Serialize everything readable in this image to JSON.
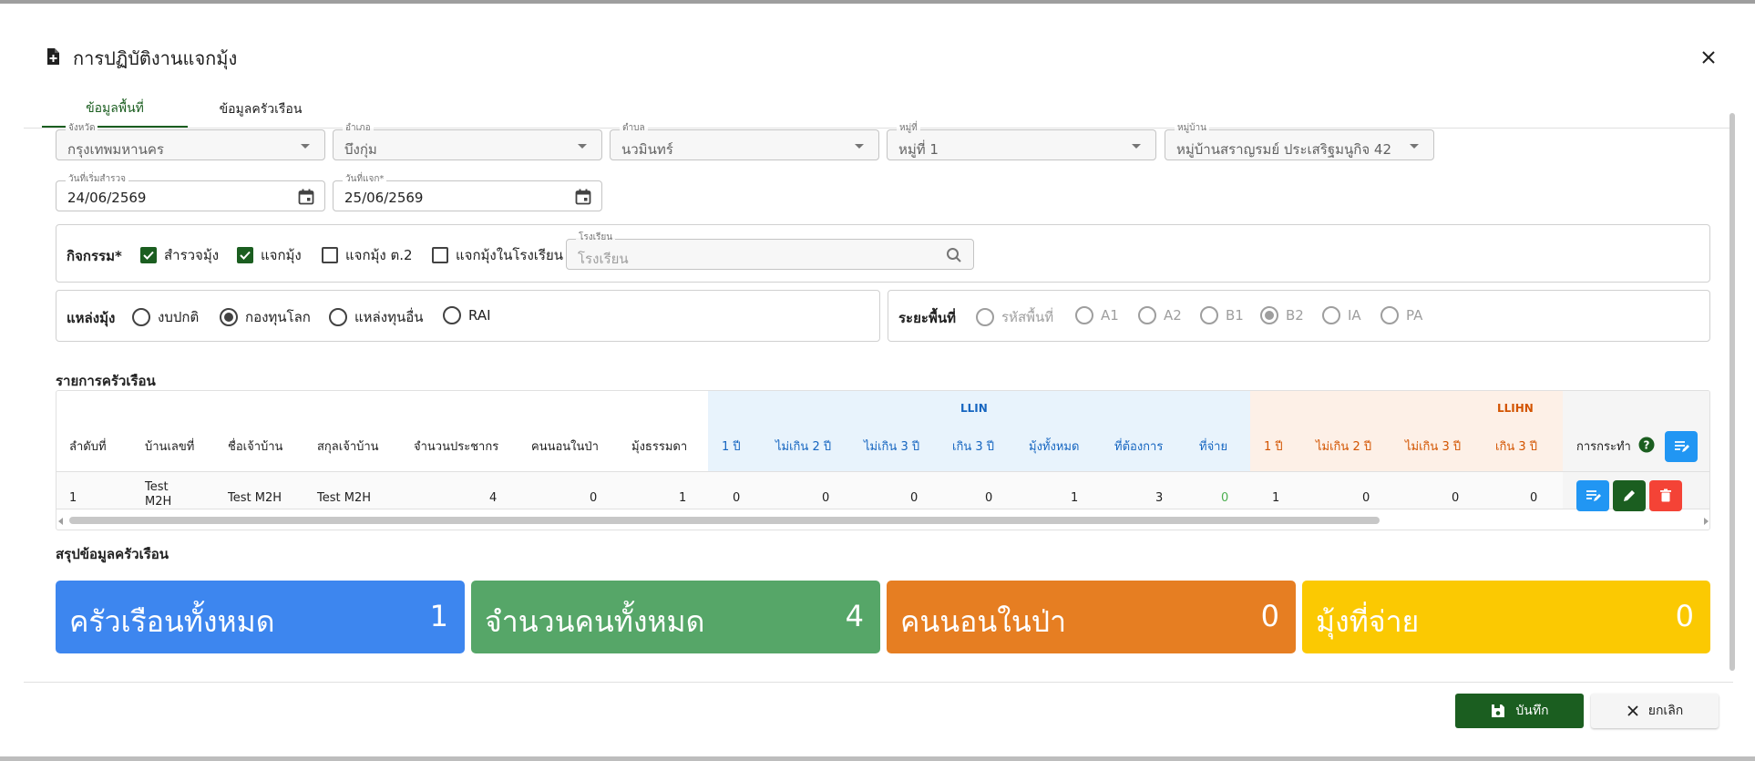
{
  "dialog": {
    "title": "การปฏิบัติงานแจกมุ้ง",
    "tabs": [
      "ข้อมูลพื้นที่",
      "ข้อมูลครัวเรือน"
    ]
  },
  "location": {
    "province": {
      "label": "จังหวัด",
      "value": "กรุงเทพมหานคร"
    },
    "district": {
      "label": "อำเภอ",
      "value": "บึงกุ่ม"
    },
    "subdistrict": {
      "label": "ตำบล",
      "value": "นวมินทร์"
    },
    "moo": {
      "label": "หมู่ที่",
      "value": "หมู่ที่ 1"
    },
    "village": {
      "label": "หมู่บ้าน",
      "value": "หมู่บ้านสราญรมย์ ประเสริฐมนูกิจ 42"
    },
    "survey_date": {
      "label": "วันที่เริ่มสำรวจ",
      "value": "24/06/2569"
    },
    "distribute_date": {
      "label": "วันที่แจก*",
      "value": "25/06/2569"
    }
  },
  "activity": {
    "label": "กิจกรรม*",
    "options": [
      {
        "label": "สำรวจมุ้ง",
        "checked": true
      },
      {
        "label": "แจกมุ้ง",
        "checked": true
      },
      {
        "label": "แจกมุ้ง ต.2",
        "checked": false
      },
      {
        "label": "แจกมุ้งในโรงเรียน",
        "checked": false
      }
    ],
    "school": {
      "label": "โรงเรียน",
      "placeholder": "โรงเรียน"
    }
  },
  "source": {
    "label": "แหล่งมุ้ง",
    "options": [
      {
        "label": "งบปกติ",
        "checked": false
      },
      {
        "label": "กองทุนโลก",
        "checked": true
      },
      {
        "label": "แหล่งทุนอื่น",
        "checked": false
      },
      {
        "label": "RAI",
        "checked": false
      }
    ]
  },
  "area_phase": {
    "label": "ระยะพื้นที่",
    "options": [
      {
        "label": "รหัสพื้นที่",
        "checked": false
      },
      {
        "label": "A1",
        "checked": false
      },
      {
        "label": "A2",
        "checked": false
      },
      {
        "label": "B1",
        "checked": false
      },
      {
        "label": "B2",
        "checked": true
      },
      {
        "label": "IA",
        "checked": false
      },
      {
        "label": "PA",
        "checked": false
      }
    ]
  },
  "household_list": {
    "title": "รายการครัวเรือน",
    "groups": {
      "llin": "LLIN",
      "llihn": "LLIHN"
    },
    "columns": [
      "ลำดับที่",
      "บ้านเลขที่",
      "ชื่อเจ้าบ้าน",
      "สกุลเจ้าบ้าน",
      "จำนวนประชากร",
      "คนนอนในป่า",
      "มุ้งธรรมดา",
      "1 ปี",
      "ไม่เกิน 2 ปี",
      "ไม่เกิน 3 ปี",
      "เกิน 3 ปี",
      "มุ้งทั้งหมด",
      "ที่ต้องการ",
      "ที่จ่าย",
      "1 ปี",
      "ไม่เกิน 2 ปี",
      "ไม่เกิน 3 ปี",
      "เกิน 3 ปี",
      "การกระทำ"
    ],
    "rows": [
      [
        "1",
        "Test M2H",
        "Test M2H",
        "Test M2H",
        "4",
        "0",
        "1",
        "0",
        "0",
        "0",
        "0",
        "1",
        "3",
        "0",
        "1",
        "0",
        "0",
        "0"
      ]
    ]
  },
  "summary": {
    "title": "สรุปข้อมูลครัวเรือน",
    "cards": [
      {
        "label": "ครัวเรือนทั้งหมด",
        "value": "1",
        "color": "#3d86ef"
      },
      {
        "label": "จำนวนคนทั้งหมด",
        "value": "4",
        "color": "#56a668"
      },
      {
        "label": "คนนอนในป่า",
        "value": "0",
        "color": "#e67e22"
      },
      {
        "label": "มุ้งที่จ่าย",
        "value": "0",
        "color": "#fbc902"
      }
    ]
  },
  "actions": {
    "save": "บันทึก",
    "cancel": "ยกเลิก"
  },
  "colors": {
    "primary_green": "#1b5e20",
    "llin_blue": "#1565c0",
    "llihn_orange": "#d35400",
    "llin_bg": "#e8f3fc",
    "llihn_bg": "#fdf0e7",
    "btn_blue": "#2196f3",
    "btn_red": "#f44336"
  }
}
